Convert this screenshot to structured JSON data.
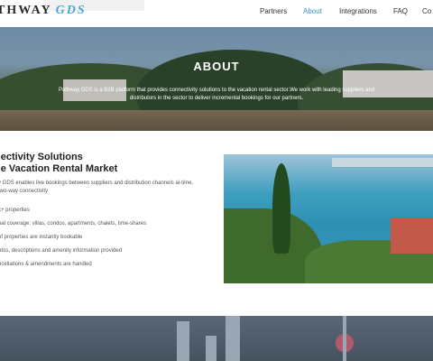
{
  "header": {
    "logo_part1": "THWAY",
    "logo_part2": "GDS",
    "nav": [
      {
        "label": "Partners",
        "active": false
      },
      {
        "label": "About",
        "active": true
      },
      {
        "label": "Integrations",
        "active": false
      },
      {
        "label": "FAQ",
        "active": false
      },
      {
        "label": "Co",
        "active": false
      }
    ]
  },
  "about": {
    "title": "ABOUT",
    "text": "Pathway GDS is a B2B platform that provides connectivity solutions to the vacation rental sector.We work with leading suppliers and distributors in the sector to deliver incremental bookings for our partners."
  },
  "connectivity": {
    "title_line1": "nectivity Solutions",
    "title_line2": "he Vacation Rental Market",
    "desc": "y GDS enables live bookings between suppliers and distribution channels al-time, two-way connectivity",
    "bullets": [
      "k+ properties",
      "bal coverage: villas, condos, apartments, chalets, time-shares",
      "of properties are instantly bookable",
      "otos, descriptions and amenity information provided",
      "ncellations & amendments are handled"
    ]
  },
  "colors": {
    "accent": "#3b8fd1",
    "logo_gds": "#4aa6d6"
  }
}
